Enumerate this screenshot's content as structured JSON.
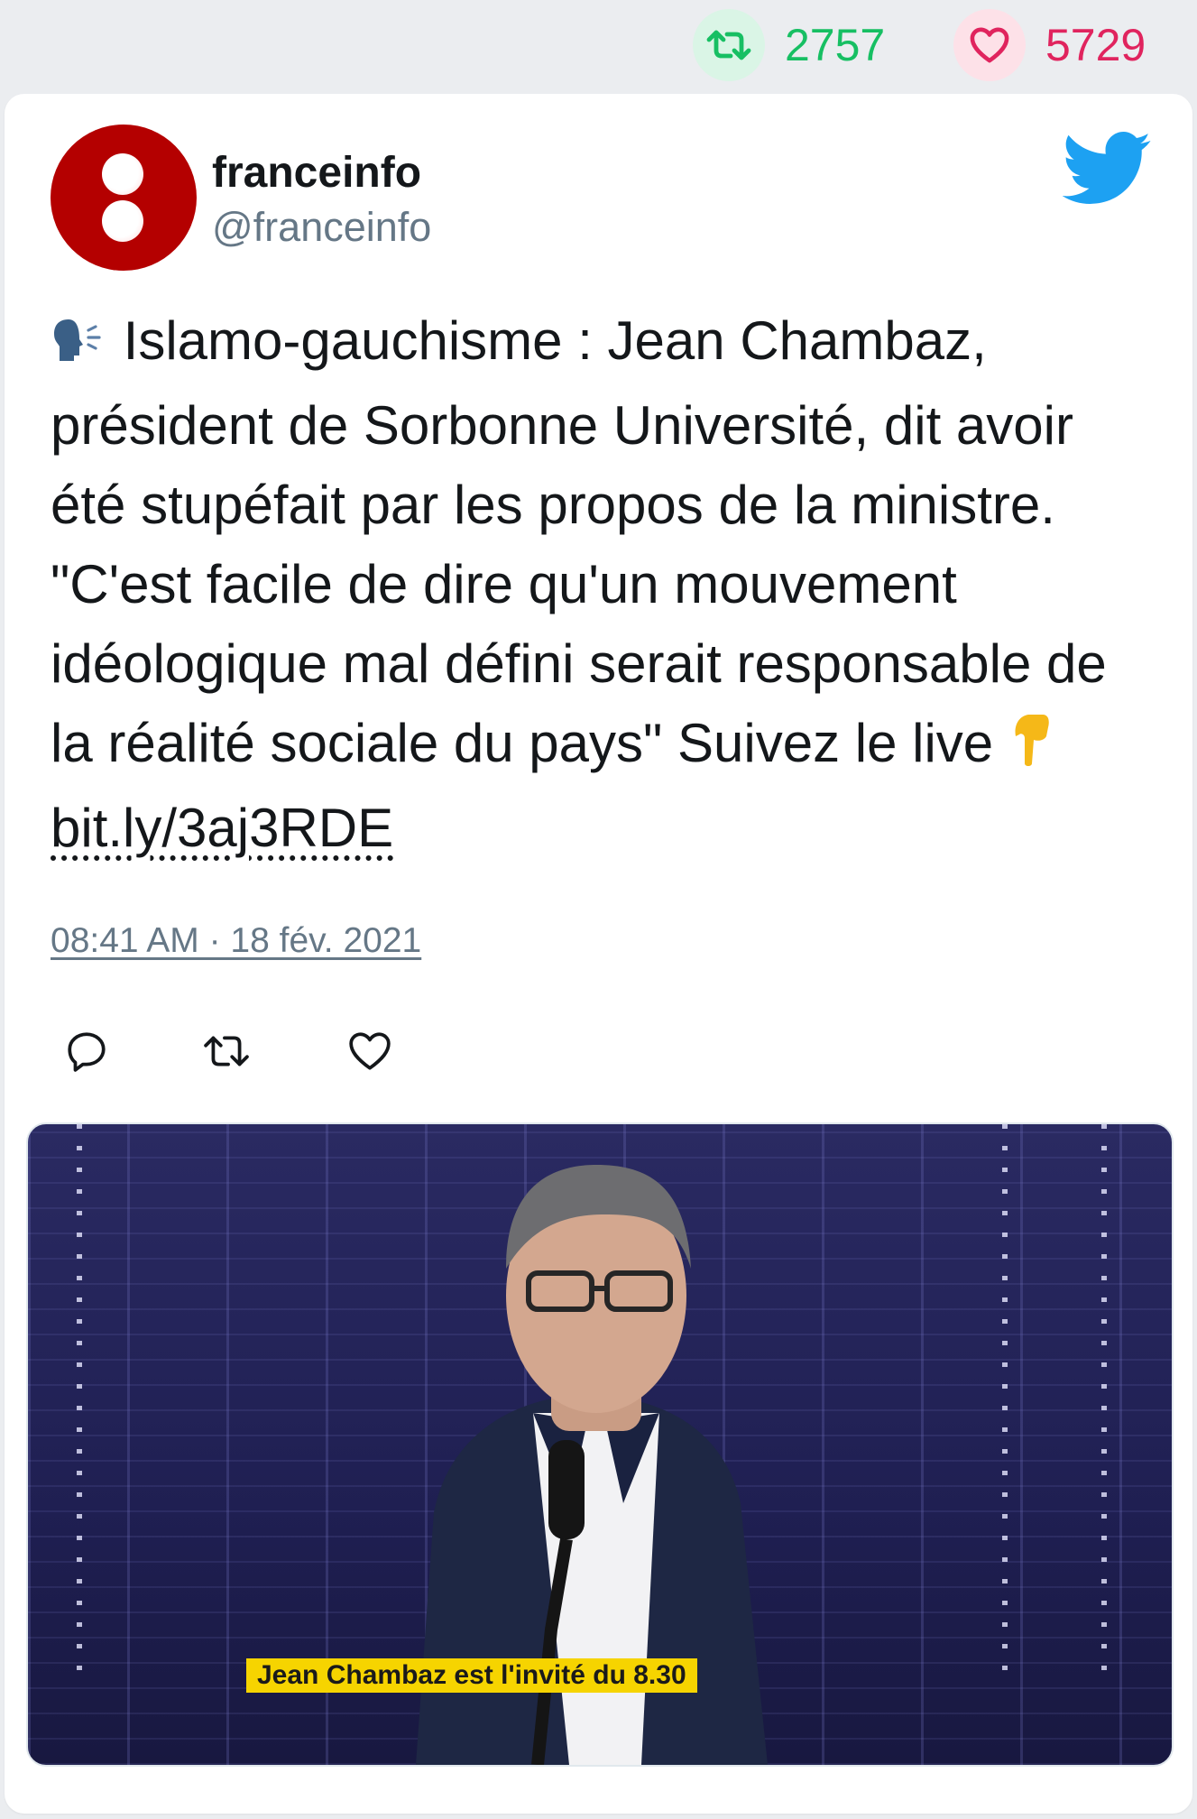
{
  "stats": {
    "retweets": "2757",
    "likes": "5729",
    "retweet_color": "#17bf63",
    "like_color": "#e0245e"
  },
  "tweet": {
    "author_name": "franceinfo",
    "author_handle": "@franceinfo",
    "avatar_color": "#b40000",
    "text_emoji_start": "🗣",
    "text_body": " Islamo-gauchisme : Jean Chambaz, président de Sorbonne Université, dit avoir été stupéfait par les propos de la ministre. \"C'est facile de dire qu'un mouvement idéologique mal défini serait responsable de la réalité sociale du pays\" Suivez le live ",
    "text_emoji_end": "👇",
    "link": "bit.ly/3aj3RDE",
    "timestamp": "08:41 AM · 18 fév. 2021",
    "actions": [
      "reply-icon",
      "retweet-icon",
      "like-icon"
    ],
    "media": {
      "caption": "Jean Chambaz est l'invité du 8.30"
    }
  }
}
